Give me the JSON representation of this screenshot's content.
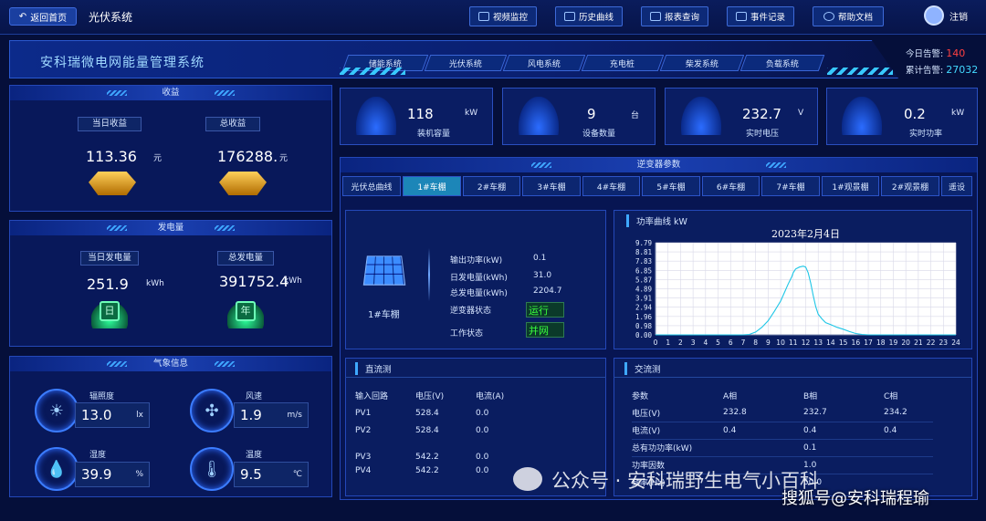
{
  "header": {
    "back_label": "返回首页",
    "system_name": "光伏系统",
    "nav": [
      {
        "label": "视频监控",
        "icon": "video-icon"
      },
      {
        "label": "历史曲线",
        "icon": "history-icon"
      },
      {
        "label": "报表查询",
        "icon": "report-search-icon"
      },
      {
        "label": "事件记录",
        "icon": "event-log-icon"
      },
      {
        "label": "帮助文档",
        "icon": "help-icon"
      }
    ],
    "user_label": "注销"
  },
  "banner": {
    "title": "安科瑞微电网能量管理系统",
    "tabs": [
      "储能系统",
      "光伏系统",
      "风电系统",
      "充电桩",
      "柴发系统",
      "负载系统"
    ]
  },
  "alarm": {
    "today_label": "今日告警:",
    "today_value": "140",
    "total_label": "累计告警:",
    "total_value": "27032"
  },
  "income": {
    "title": "收益",
    "today_label": "当日收益",
    "today_value": "113.36",
    "today_unit": "元",
    "total_label": "总收益",
    "total_value": "176288.",
    "total_unit": "元"
  },
  "generation": {
    "title": "发电量",
    "today_label": "当日发电量",
    "today_value": "251.9",
    "today_unit": "kWh",
    "today_icon_text": "日",
    "total_label": "总发电量",
    "total_value": "391752.4",
    "total_unit": "kWh",
    "total_icon_text": "年"
  },
  "weather": {
    "title": "气象信息",
    "items": [
      {
        "label": "辐照度",
        "value": "13.0",
        "unit": "lx",
        "icon": "sun-icon"
      },
      {
        "label": "风速",
        "value": "1.9",
        "unit": "m/s",
        "icon": "fan-icon"
      },
      {
        "label": "湿度",
        "value": "39.9",
        "unit": "%",
        "icon": "humidity-icon"
      },
      {
        "label": "温度",
        "value": "9.5",
        "unit": "℃",
        "icon": "thermometer-icon"
      }
    ]
  },
  "cards": [
    {
      "value": "118",
      "unit": "kW",
      "label": "装机容量",
      "icon": "solar-capacity-icon"
    },
    {
      "value": "9",
      "unit": "台",
      "label": "设备数量",
      "icon": "device-icon"
    },
    {
      "value": "232.7",
      "unit": "V",
      "label": "实时电压",
      "icon": "voltage-gauge-icon"
    },
    {
      "value": "0.2",
      "unit": "kW",
      "label": "实时功率",
      "icon": "power-icon"
    }
  ],
  "inverter": {
    "title": "逆变器参数",
    "tabs": [
      "光伏总曲线",
      "1#车棚",
      "2#车棚",
      "3#车棚",
      "4#车棚",
      "5#车棚",
      "6#车棚",
      "7#车棚",
      "1#观景棚",
      "2#观景棚",
      "遥设"
    ],
    "active_tab": 1,
    "device_name": "1#车棚",
    "params": [
      {
        "label": "输出功率(kW)",
        "value": "0.1"
      },
      {
        "label": "日发电量(kWh)",
        "value": "31.0"
      },
      {
        "label": "总发电量(kWh)",
        "value": "2204.7"
      }
    ],
    "inverter_status_label": "逆变器状态",
    "inverter_status_value": "运行",
    "work_status_label": "工作状态",
    "work_status_value": "并网"
  },
  "power_curve": {
    "title": "功率曲线  kW"
  },
  "chart_data": {
    "type": "line",
    "title": "2023年2月4日",
    "xlabel": "",
    "ylabel": "",
    "xlim": [
      0,
      24
    ],
    "ylim": [
      0,
      9.79
    ],
    "x_ticks": [
      "0",
      "1",
      "2",
      "3",
      "4",
      "5",
      "6",
      "7",
      "8",
      "9",
      "10",
      "11",
      "12",
      "13",
      "14",
      "15",
      "16",
      "17",
      "18",
      "19",
      "20",
      "21",
      "22",
      "23",
      "24"
    ],
    "y_ticks": [
      "0.00",
      "0.98",
      "1.96",
      "2.94",
      "3.91",
      "4.89",
      "5.87",
      "6.85",
      "7.83",
      "8.81",
      "9.79"
    ],
    "grid": true,
    "series": [
      {
        "x": [
          0,
          1,
          2,
          3,
          4,
          5,
          6,
          7,
          7.5,
          8,
          8.5,
          9,
          9.5,
          10,
          10.3,
          10.6,
          10.9,
          11,
          11.2,
          11.5,
          11.8,
          12,
          12.2,
          12.4,
          12.6,
          12.8,
          13,
          13.3,
          13.6,
          14,
          14.5,
          15,
          15.5,
          16,
          16.5,
          17,
          18,
          19,
          20,
          21,
          22,
          23,
          24
        ],
        "y": [
          0,
          0,
          0,
          0,
          0,
          0,
          0,
          0,
          0.05,
          0.3,
          0.8,
          1.5,
          2.5,
          3.6,
          4.5,
          5.4,
          6.2,
          6.6,
          7.0,
          7.2,
          7.3,
          7.2,
          6.6,
          5.5,
          4.2,
          3.0,
          2.2,
          1.7,
          1.3,
          1.1,
          0.8,
          0.6,
          0.35,
          0.15,
          0.05,
          0,
          0,
          0,
          0,
          0,
          0,
          0,
          0
        ]
      }
    ]
  },
  "dc_side": {
    "title": "直流测",
    "headers": [
      "输入回路",
      "电压(V)",
      "电流(A)"
    ],
    "rows": [
      [
        "PV1",
        "528.4",
        "0.0"
      ],
      [
        "PV2",
        "528.4",
        "0.0"
      ],
      [
        "PV3",
        "542.2",
        "0.0"
      ],
      [
        "PV4",
        "542.2",
        "0.0"
      ]
    ]
  },
  "ac_side": {
    "title": "交流测",
    "headers": [
      "参数",
      "A相",
      "B相",
      "C相"
    ],
    "rows": [
      [
        "电压(V)",
        "232.8",
        "232.7",
        "234.2"
      ],
      [
        "电流(V)",
        "0.4",
        "0.4",
        "0.4"
      ],
      [
        "总有功功率(kW)",
        "",
        "0.1",
        ""
      ],
      [
        "功率因数",
        "",
        "1.0",
        ""
      ],
      [
        "频率(Hz)",
        "",
        "50.0",
        ""
      ]
    ]
  },
  "watermarks": {
    "wechat": "公众号 · 安科瑞野生电气小百科",
    "sohu": "搜狐号@安科瑞程瑜"
  }
}
